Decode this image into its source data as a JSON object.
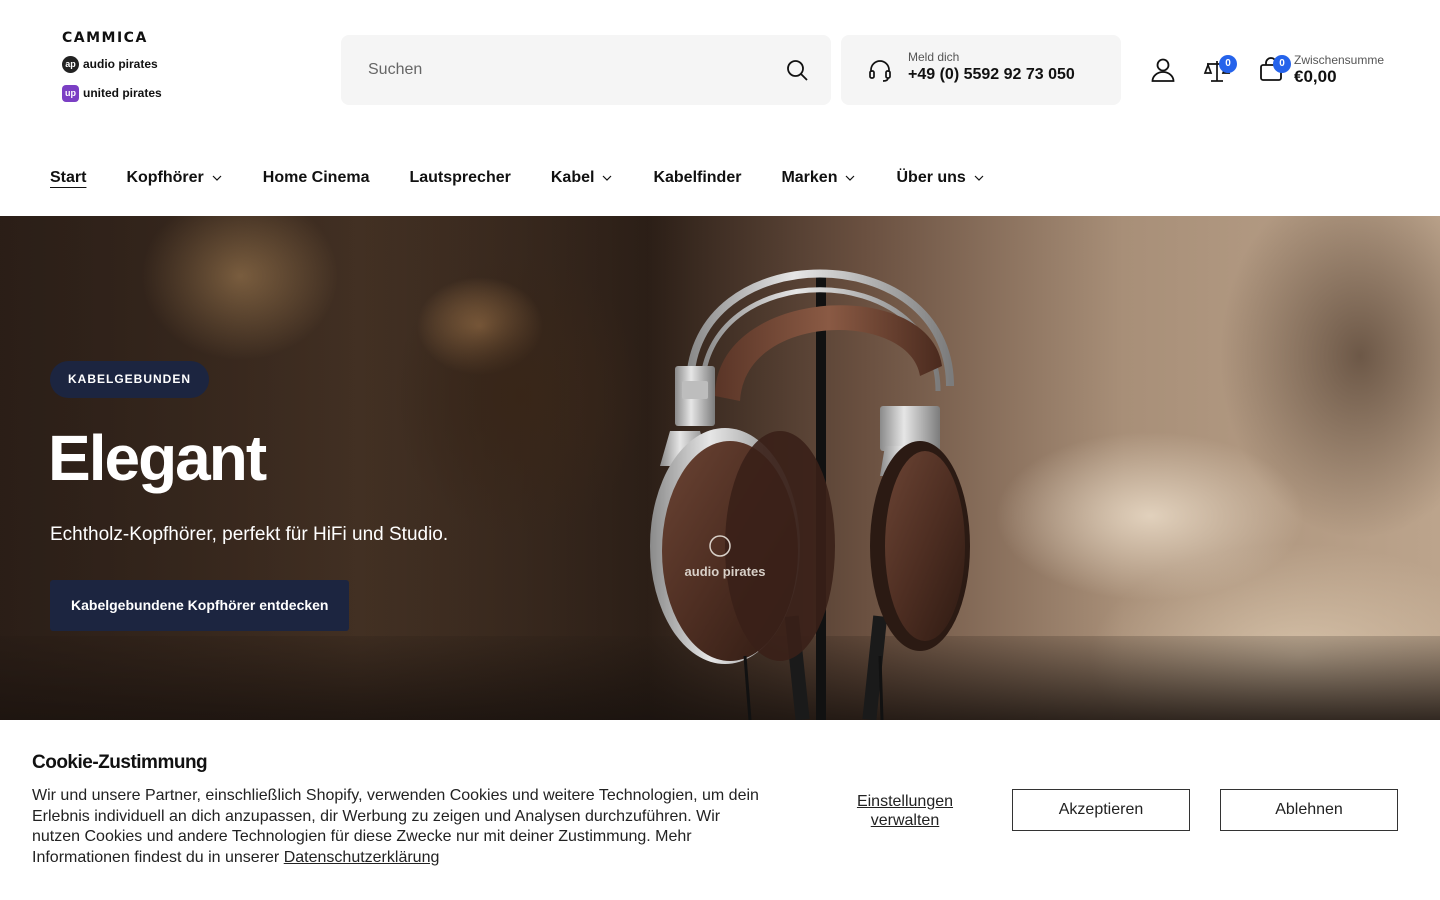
{
  "header": {
    "logos": {
      "cammica": "CAMMICA",
      "audio_pirates": "audio pirates",
      "united_pirates": "united pirates"
    },
    "search": {
      "placeholder": "Suchen"
    },
    "contact": {
      "label": "Meld dich",
      "phone": "+49 (0) 5592 92 73 050"
    },
    "compare_count": "0",
    "cart": {
      "count": "0",
      "label": "Zwischensumme",
      "total": "€0,00"
    },
    "icons": [
      "search-icon",
      "headset-icon",
      "user-icon",
      "scale-icon",
      "bag-icon"
    ]
  },
  "nav": {
    "items": [
      {
        "label": "Start",
        "active": true,
        "dropdown": false
      },
      {
        "label": "Kopfhörer",
        "dropdown": true
      },
      {
        "label": "Home Cinema",
        "dropdown": false
      },
      {
        "label": "Lautsprecher",
        "dropdown": false
      },
      {
        "label": "Kabel",
        "dropdown": true
      },
      {
        "label": "Kabelfinder",
        "dropdown": false
      },
      {
        "label": "Marken",
        "dropdown": true
      },
      {
        "label": "Über uns",
        "dropdown": true
      }
    ]
  },
  "hero": {
    "tag": "KABELGEBUNDEN",
    "title": "Elegant",
    "subtitle": "Echtholz-Kopfhörer, perfekt für HiFi und Studio.",
    "cta": "Kabelgebundene Kopfhörer entdecken",
    "product_brand": "audio pirates"
  },
  "cookie": {
    "title": "Cookie-Zustimmung",
    "text": "Wir und unsere Partner, einschließlich Shopify, verwenden Cookies und weitere Technologien, um dein Erlebnis individuell an dich anzupassen, dir Werbung zu zeigen und Analysen durchzuführen. Wir nutzen Cookies und andere Technologien für diese Zwecke nur mit deiner Zustimmung. Mehr Informationen findest du in unserer",
    "link": "Datenschutzerklärung",
    "manage": "Einstellungen verwalten",
    "accept": "Akzeptieren",
    "decline": "Ablehnen"
  },
  "colors": {
    "accent_dark": "#1c2540",
    "badge_blue": "#2563eb"
  }
}
